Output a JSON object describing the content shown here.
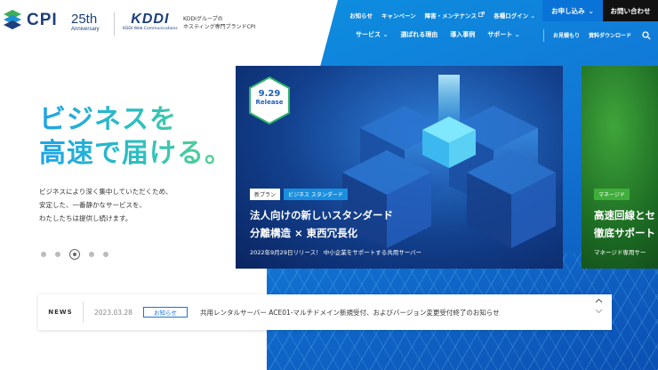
{
  "header": {
    "logo_text": "CPI",
    "anniversary_number": "25th",
    "anniversary_label": "Anniversary",
    "partner_logo": "KDDI",
    "partner_sub": "KDDI Web Communications",
    "partner_desc_line1": "KDDIグループの",
    "partner_desc_line2": "ホスティング専門ブランドCPI",
    "utility_links": [
      "お知らせ",
      "キャンペーン",
      "障害・メンテナンス",
      "各種ログイン"
    ],
    "apply_label": "お申し込み",
    "contact_label": "お問い合わせ",
    "main_nav": [
      "サービス",
      "選ばれる理由",
      "導入事例",
      "サポート"
    ],
    "sub_nav": [
      "お見積もり",
      "資料ダウンロード"
    ]
  },
  "hero": {
    "headline_line1": "ビジネスを",
    "headline_line2": "高速で届ける。",
    "sub_line1": "ビジネスにより深く集中していただくため、",
    "sub_line2": "安定した、一番静かなサービスを、",
    "sub_line3": "わたしたちは提供し続けます。",
    "slide_count": 5,
    "active_slide": 3
  },
  "slides": [
    {
      "badge_date": "9.29",
      "badge_label": "Release",
      "tags": [
        "新プラン",
        "ビジネス スタンダード"
      ],
      "title_line1": "法人向けの新しいスタンダード",
      "title_line2": "分離構造 × 東西冗長化",
      "desc": "2022年9月29日リリース！ 中小企業をサポートする共用サーバー"
    },
    {
      "tag": "マネージド",
      "title_line1": "高速回線とセ",
      "title_line2": "徹底サポート",
      "desc": "マネージド専用サー"
    }
  ],
  "news": {
    "label": "NEWS",
    "date": "2023.03.28",
    "category": "お知らせ",
    "text": "共用レンタルサーバー ACE01-マルチドメイン新規受付、およびバージョン変更受付終了のお知らせ"
  }
}
